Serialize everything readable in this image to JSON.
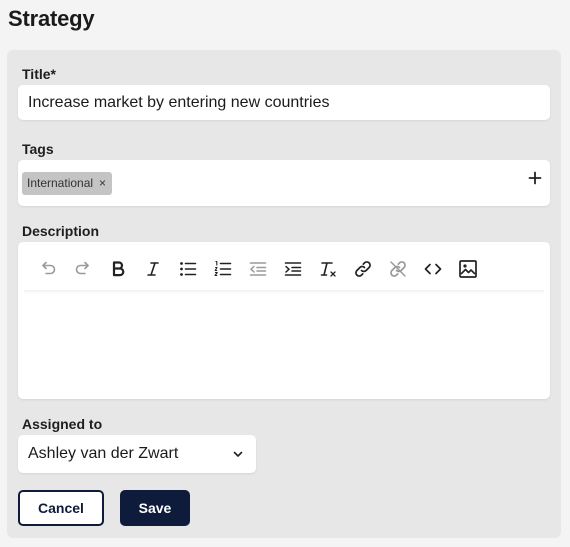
{
  "page": {
    "title": "Strategy"
  },
  "form": {
    "title_label": "Title*",
    "title_value": "Increase market by entering new countries",
    "tags_label": "Tags",
    "tags": [
      {
        "label": "International",
        "remove": "×"
      }
    ],
    "add_tag_icon": "plus-icon",
    "description_label": "Description",
    "toolbar": [
      {
        "name": "undo-icon",
        "enabled": false
      },
      {
        "name": "redo-icon",
        "enabled": false
      },
      {
        "name": "bold-icon",
        "enabled": true
      },
      {
        "name": "italic-icon",
        "enabled": true
      },
      {
        "name": "bullet-list-icon",
        "enabled": true
      },
      {
        "name": "numbered-list-icon",
        "enabled": true
      },
      {
        "name": "outdent-icon",
        "enabled": false
      },
      {
        "name": "indent-icon",
        "enabled": true
      },
      {
        "name": "clear-format-icon",
        "enabled": true
      },
      {
        "name": "link-icon",
        "enabled": true
      },
      {
        "name": "unlink-icon",
        "enabled": false
      },
      {
        "name": "code-icon",
        "enabled": true
      },
      {
        "name": "image-icon",
        "enabled": true
      }
    ],
    "description_value": "",
    "assigned_label": "Assigned to",
    "assigned_value": "Ashley van der Zwart",
    "cancel_label": "Cancel",
    "save_label": "Save"
  },
  "colors": {
    "primary": "#0e1b3a",
    "background": "#f4f4f4",
    "card": "#e7e7e7",
    "chip": "#c4c4c4",
    "icon_enabled": "#222222",
    "icon_disabled": "#9a9a9a"
  }
}
